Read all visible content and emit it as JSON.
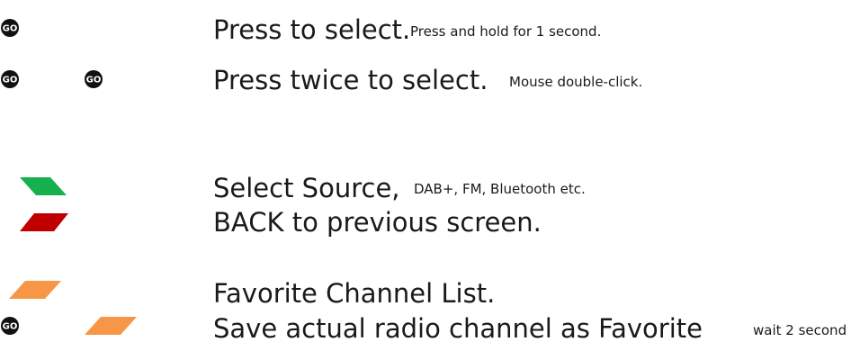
{
  "legend": {
    "items": [
      {
        "main": "Press to select.",
        "note": "Press and hold for 1 second.",
        "icons": [
          "go-icon"
        ]
      },
      {
        "main": "Press twice to select.",
        "note": "Mouse double-click.",
        "icons": [
          "go-icon",
          "go-icon"
        ]
      },
      {
        "main": "Select Source,",
        "note": "DAB+, FM, Bluetooth etc.",
        "icons": [
          "green-select-source-icon"
        ]
      },
      {
        "main": "BACK to previous screen.",
        "note": "",
        "icons": [
          "red-back-icon"
        ]
      },
      {
        "main": "Favorite Channel List.",
        "note": "",
        "icons": [
          "orange-favorite-icon"
        ]
      },
      {
        "main": "Save actual radio channel as Favorite",
        "note": "wait 2 second",
        "icons": [
          "go-icon",
          "orange-favorite-icon"
        ]
      }
    ]
  },
  "colors": {
    "go_icon": "#111111",
    "green": "#16b04f",
    "red": "#c00000",
    "orange": "#f79646",
    "text": "#1a1a1a"
  }
}
